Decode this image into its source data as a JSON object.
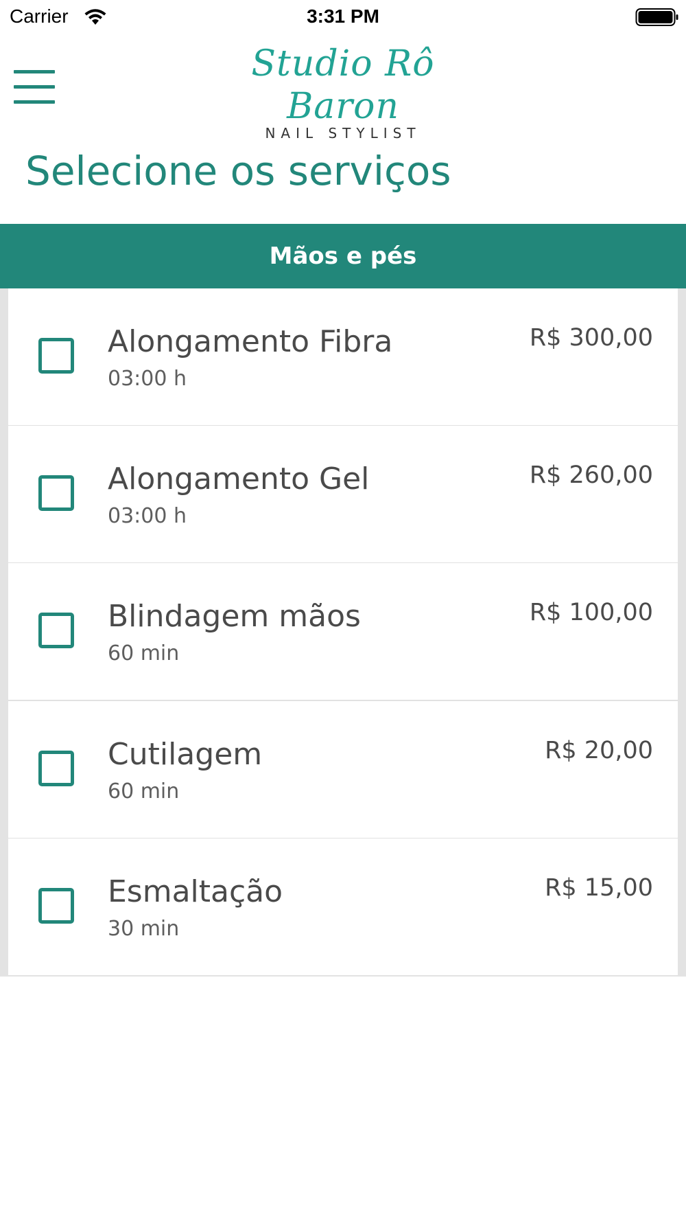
{
  "status_bar": {
    "carrier": "Carrier",
    "time": "3:31 PM",
    "wifi_icon": "wifi-icon",
    "battery_icon": "battery-full-icon"
  },
  "header": {
    "menu_icon": "hamburger-menu-icon",
    "logo": {
      "script": "Studio Rô Baron",
      "subtitle": "NAIL STYLIST"
    }
  },
  "page": {
    "title": "Selecione os serviços"
  },
  "category": {
    "label": "Mãos e pés"
  },
  "services": [
    {
      "name": "Alongamento Fibra",
      "duration": "03:00 h",
      "price": "R$ 300,00",
      "checked": false
    },
    {
      "name": "Alongamento Gel",
      "duration": "03:00 h",
      "price": "R$ 260,00",
      "checked": false
    },
    {
      "name": "Blindagem mãos",
      "duration": "60 min",
      "price": "R$ 100,00",
      "checked": false
    },
    {
      "name": "Cutilagem",
      "duration": "60 min",
      "price": "R$ 20,00",
      "checked": false
    },
    {
      "name": "Esmaltação",
      "duration": "30 min",
      "price": "R$ 15,00",
      "checked": false
    }
  ],
  "colors": {
    "accent": "#22877a",
    "logo": "#22a394",
    "text": "#4a4a4a",
    "list_background": "#e3e3e3"
  }
}
